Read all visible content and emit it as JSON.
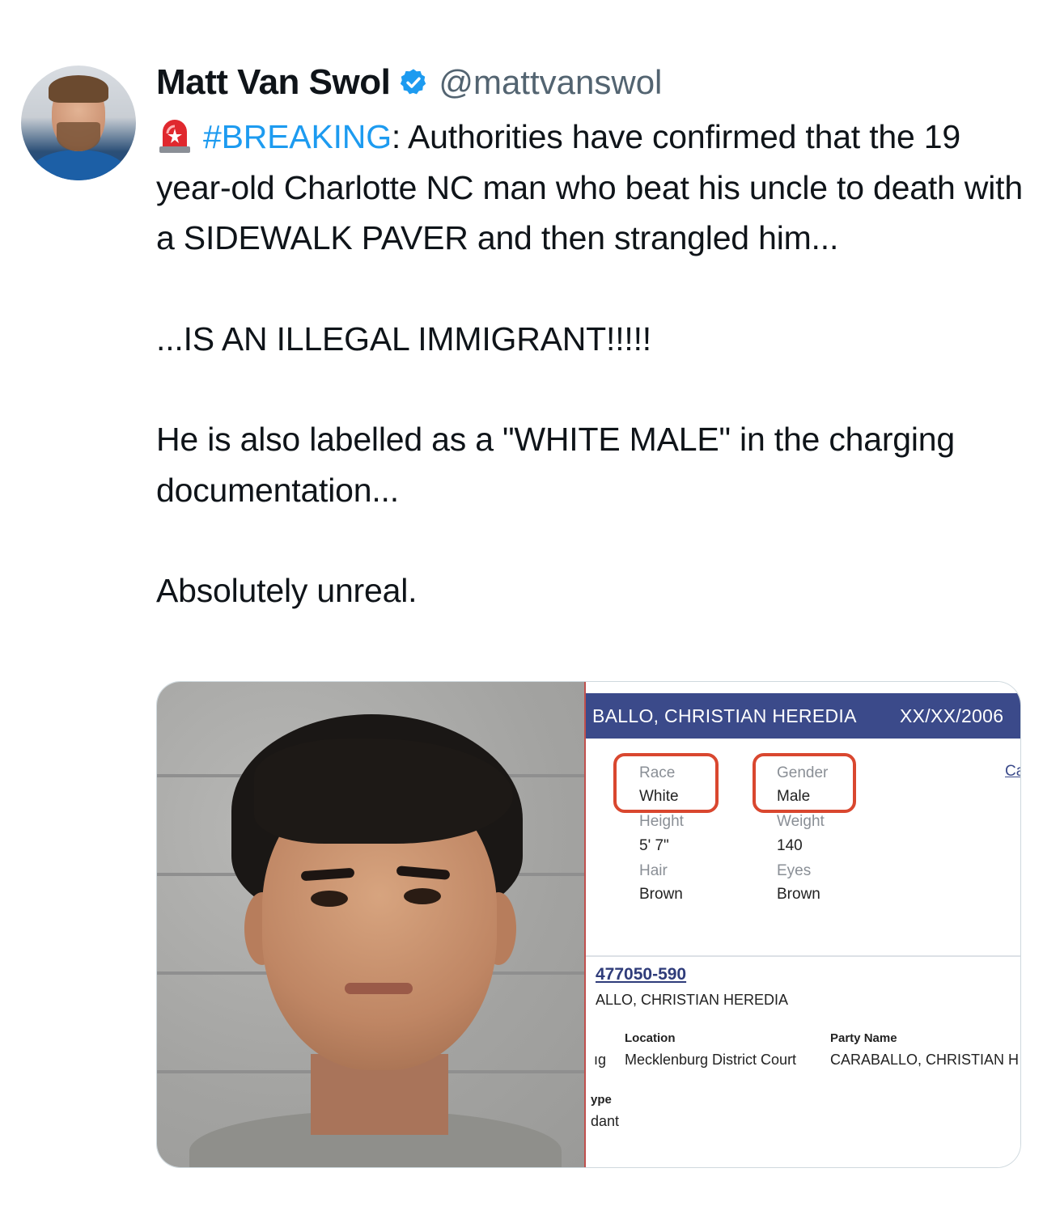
{
  "author": {
    "name": "Matt Van Swol",
    "handle": "@mattvanswol",
    "verified": true
  },
  "tweet": {
    "hashtag": "#BREAKING",
    "line1_rest": ": Authorities have confirmed that the 19 year-old Charlotte NC man who beat his uncle to death with a SIDEWALK PAVER and then strangled him...",
    "para2": "...IS AN ILLEGAL IMMIGRANT!!!!!",
    "para3": "He is also labelled as a \"WHITE MALE\" in the charging documentation...",
    "para4": "Absolutely unreal."
  },
  "record": {
    "header_name": "BALLO, CHRISTIAN HEREDIA",
    "header_dob": "XX/XX/2006",
    "race_label": "Race",
    "race_value": "White",
    "gender_label": "Gender",
    "gender_value": "Male",
    "height_label": "Height",
    "height_value": "5' 7\"",
    "weight_label": "Weight",
    "weight_value": "140",
    "hair_label": "Hair",
    "hair_value": "Brown",
    "eyes_label": "Eyes",
    "eyes_value": "Brown",
    "ca_link": "Ca",
    "case_number": "477050-590",
    "case_name": "ALLO, CHRISTIAN HEREDIA",
    "location_label": "Location",
    "location_value": "Mecklenburg District Court",
    "party_label": "Party Name",
    "party_value": "CARABALLO, CHRISTIAN H",
    "left_clip_1": "ıg",
    "left_clip_2": "ype",
    "left_clip_3": "dant"
  },
  "icons": {
    "verified": "verified-badge-icon",
    "siren": "rotating-light-icon"
  },
  "colors": {
    "hashtag": "#1d9bf0",
    "verified": "#1d9bf0",
    "record_header": "#3b4a8a",
    "highlight_box": "#d9472f"
  }
}
